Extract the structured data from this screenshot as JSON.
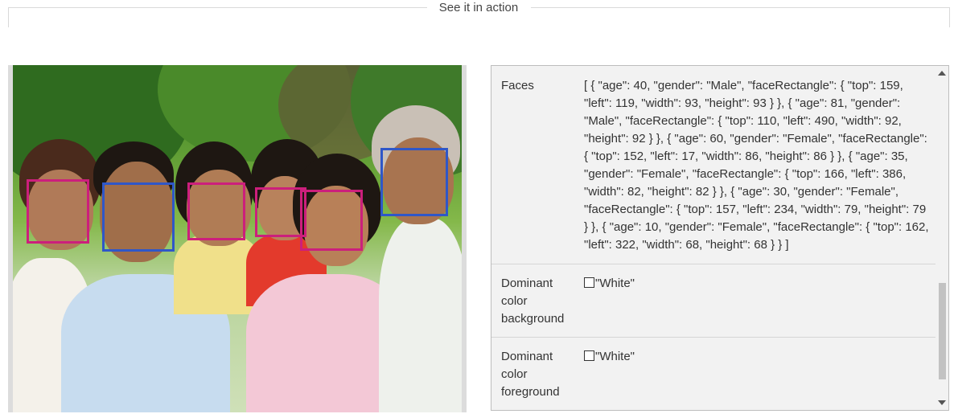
{
  "section": {
    "title": "See it in action"
  },
  "photo": {
    "alt": "Family photo with detected faces"
  },
  "results": {
    "rows": [
      {
        "label": "Faces",
        "value": "[ { \"age\": 40, \"gender\": \"Male\", \"faceRectangle\": { \"top\": 159, \"left\": 119, \"width\": 93, \"height\": 93 } }, { \"age\": 81, \"gender\": \"Male\", \"faceRectangle\": { \"top\": 110, \"left\": 490, \"width\": 92, \"height\": 92 } }, { \"age\": 60, \"gender\": \"Female\", \"faceRectangle\": { \"top\": 152, \"left\": 17, \"width\": 86, \"height\": 86 } }, { \"age\": 35, \"gender\": \"Female\", \"faceRectangle\": { \"top\": 166, \"left\": 386, \"width\": 82, \"height\": 82 } }, { \"age\": 30, \"gender\": \"Female\", \"faceRectangle\": { \"top\": 157, \"left\": 234, \"width\": 79, \"height\": 79 } }, { \"age\": 10, \"gender\": \"Female\", \"faceRectangle\": { \"top\": 162, \"left\": 322, \"width\": 68, \"height\": 68 } } ]"
      },
      {
        "label": "Dominant color background",
        "value": "\"White\"",
        "swatch_color": "#ffffff"
      },
      {
        "label": "Dominant color foreground",
        "value": "\"White\"",
        "swatch_color": "#ffffff"
      }
    ]
  },
  "colors": {
    "male_box": "#2f57c8",
    "female_box": "#cc1f7c"
  }
}
